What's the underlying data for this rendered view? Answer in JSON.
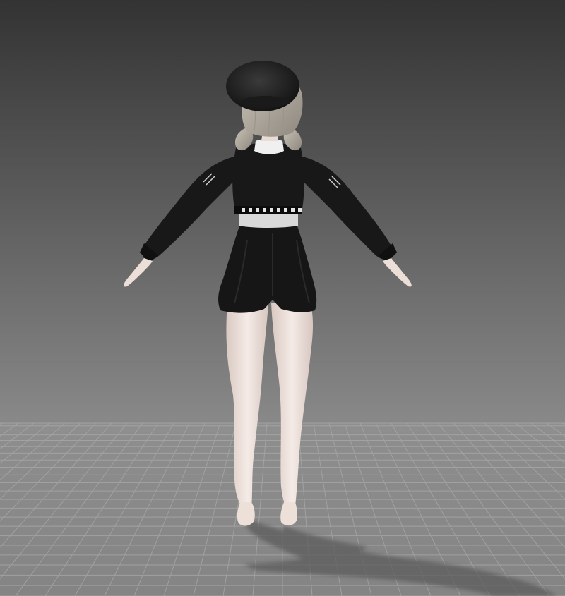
{
  "viewport": {
    "background_top": "#333333",
    "background_bottom": "#8c8c8c",
    "floor_color": "#8a8a8a",
    "grid_line_color": "#a5a5a5"
  },
  "character": {
    "outfit_color": "#161616",
    "skin_color": "#efe3dc",
    "hair_color": "#b8b1a6",
    "beret_color": "#1e1e1e",
    "collar_color": "#f2f2f2",
    "shadow_color": "#5a5a5a"
  }
}
